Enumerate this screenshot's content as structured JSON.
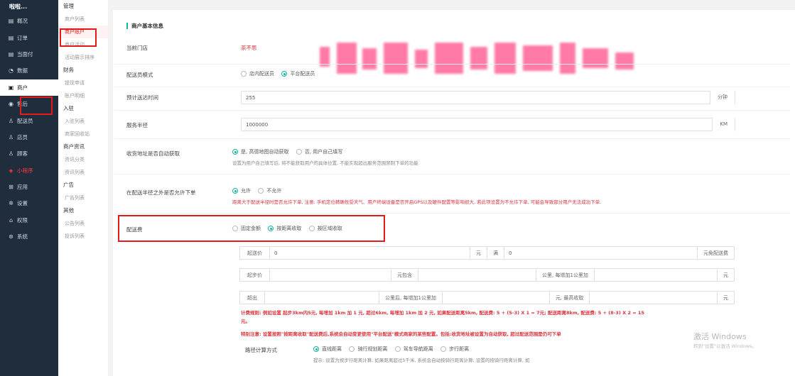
{
  "app": {
    "brand": "啦啦..."
  },
  "nav": [
    {
      "label": "概况",
      "icon": "overview-icon",
      "glyph": "▤"
    },
    {
      "label": "订单",
      "icon": "order-icon",
      "glyph": "▤"
    },
    {
      "label": "当面付",
      "icon": "pay-icon",
      "glyph": "▤"
    },
    {
      "label": "数据",
      "icon": "data-icon",
      "glyph": "◔"
    },
    {
      "label": "商户",
      "icon": "merchant-icon",
      "glyph": "▣"
    },
    {
      "label": "售后",
      "icon": "after-sale-icon",
      "glyph": "◉"
    },
    {
      "label": "配送员",
      "icon": "courier-icon",
      "glyph": "♙"
    },
    {
      "label": "店员",
      "icon": "clerk-icon",
      "glyph": "♙"
    },
    {
      "label": "顾客",
      "icon": "customer-icon",
      "glyph": "♙"
    },
    {
      "label": "小程序",
      "icon": "miniprogram-icon",
      "glyph": "◈"
    },
    {
      "label": "应用",
      "icon": "app-icon",
      "glyph": "⊞"
    },
    {
      "label": "设置",
      "icon": "settings-icon",
      "glyph": "✲"
    },
    {
      "label": "权限",
      "icon": "permission-icon",
      "glyph": "⌂"
    },
    {
      "label": "系统",
      "icon": "system-icon",
      "glyph": "⊛"
    }
  ],
  "subnav": [
    {
      "type": "group",
      "label": "管理"
    },
    {
      "type": "item",
      "label": "商户列表"
    },
    {
      "type": "item",
      "label": "商户账户",
      "active": true
    },
    {
      "type": "item",
      "label": "商户活动"
    },
    {
      "type": "item",
      "label": "活动展示排序"
    },
    {
      "type": "group",
      "label": "财务"
    },
    {
      "type": "item",
      "label": "提现申请"
    },
    {
      "type": "item",
      "label": "账户明细"
    },
    {
      "type": "group",
      "label": "入驻"
    },
    {
      "type": "item",
      "label": "入驻列表"
    },
    {
      "type": "item",
      "label": "商家回收站"
    },
    {
      "type": "group",
      "label": "商户资讯"
    },
    {
      "type": "item",
      "label": "资讯分类"
    },
    {
      "type": "item",
      "label": "资讯列表"
    },
    {
      "type": "group",
      "label": "广告"
    },
    {
      "type": "item",
      "label": "广告列表"
    },
    {
      "type": "group",
      "label": "其他"
    },
    {
      "type": "item",
      "label": "公告列表"
    },
    {
      "type": "item",
      "label": "投诉列表"
    }
  ],
  "section_title": "商户基本信息",
  "form": {
    "store": {
      "label": "当前门店",
      "value": "茶不思"
    },
    "courier_mode": {
      "label": "配送员模式",
      "options": [
        "店内配送员",
        "平台配送员"
      ],
      "selected": 1
    },
    "delivery_time": {
      "label": "预计送达时间",
      "value": "255",
      "suffix": "分钟"
    },
    "radius": {
      "label": "服务半径",
      "value": "1000000",
      "suffix": "KM"
    },
    "auto_address": {
      "label": "收货地址是否自动获取",
      "options": [
        "是, 高德地图自动获取",
        "否, 用户自己填写"
      ],
      "selected": 0,
      "hint": "设置为用户自己填写后, 将不能获取用户的具体位置, 不能实现超出服务范围禁制下单的功能"
    },
    "outside_order": {
      "label": "在配送半径之外是否允许下单",
      "options": [
        "允许",
        "不允许"
      ],
      "selected": 0,
      "warn": "距离大于配送半径时是否允许下单, 注意: 手机定位精确性受天气、用户终端设备是否开启GPS以及硬件配置等影响很大, 若此项设置为不允许下单, 可能会导致部分用户无法成功下单."
    },
    "delivery_fee": {
      "label": "配送费",
      "options": [
        "固定金额",
        "按距离收取",
        "按区域收取"
      ],
      "selected": 1,
      "row1": {
        "start_label": "起送价",
        "start_value": "0",
        "unit": "元",
        "full_label": "满",
        "full_value": "0",
        "free_label": "元免配送费"
      },
      "row2": {
        "base_label": "起步价",
        "includes_label": "元包含",
        "per_km_label": "公里, 每增加1公里加",
        "unit": "元"
      },
      "row3": {
        "over_label": "超出",
        "after_label": "公里后, 每增加1公里加",
        "max_label": "元, 最高收取",
        "unit": "元"
      },
      "rule_line1": "计费规则: 例如设置 起步3km内5元, 每增加 1km 加 1 元, 超过6km, 每增加 1km 加 2 元, 如果配送距离5km, 配送费: 5 + (5-3) X 1 = 7元; 配送距离8km, 配送费: 5 + (8-3) X 2 = 15",
      "rule_line2": "元。",
      "special_note": "特别注意: 设置按照\"按距离收取\"配送费后,系统会自动变更使用\"平台配送\"模式商家的某些配置。包括:收货地址被设置为自动获取, 超过配送范围是仍可下单"
    },
    "route_calc": {
      "label": "路径计算方式",
      "options": [
        "直线距离",
        "骑行规划距离",
        "驾车导航距离",
        "步行距离"
      ],
      "selected": 0,
      "hint": "提示: 设置为按步行距离计算, 如果距离超过5千米, 系统会自动按骑行距离计算; 设置的按骑行距离计算, 如"
    }
  },
  "watermark": {
    "line1": "激活 Windows",
    "line2": "转到\"设置\"以激活 Windows。"
  }
}
